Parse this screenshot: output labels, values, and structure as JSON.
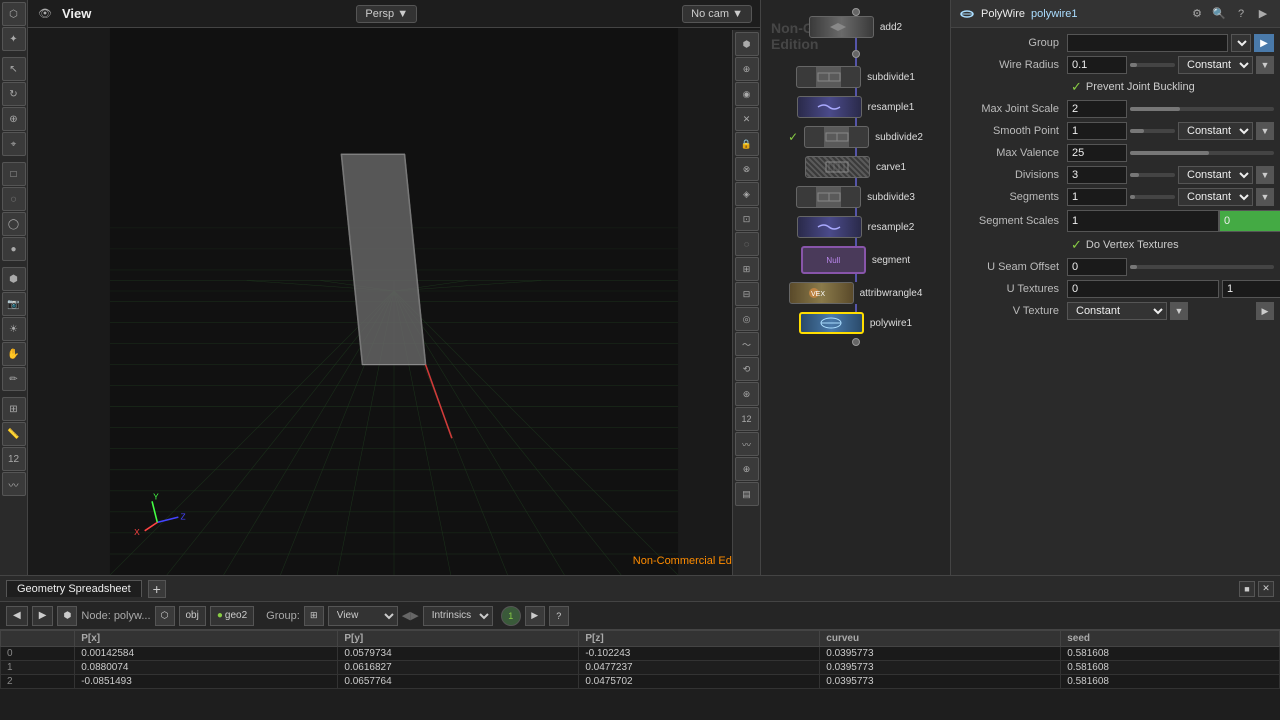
{
  "app": {
    "title": "PolyWire",
    "node_name": "polywire1"
  },
  "viewport": {
    "title": "View",
    "persp_label": "Persp",
    "cam_label": "No cam",
    "non_commercial": "Non-Commercial Edition"
  },
  "properties": {
    "title": "PolyWire",
    "node": "polywire1",
    "rows": [
      {
        "label": "Group",
        "type": "text_dropdown",
        "value": ""
      },
      {
        "label": "Wire Radius",
        "type": "slider_constant",
        "value": "0.1",
        "slider_pct": 15,
        "constant": "Constant"
      },
      {
        "label": "",
        "type": "checkbox",
        "text": "Prevent Joint Buckling",
        "checked": true
      },
      {
        "label": "Max Joint Scale",
        "type": "slider",
        "value": "2",
        "slider_pct": 35
      },
      {
        "label": "Smooth Point",
        "type": "slider_constant",
        "value": "1",
        "slider_pct": 30,
        "constant": "Constant"
      },
      {
        "label": "Max Valence",
        "type": "slider",
        "value": "25",
        "slider_pct": 55
      },
      {
        "label": "Divisions",
        "type": "slider_constant",
        "value": "3",
        "slider_pct": 20,
        "constant": "Constant"
      },
      {
        "label": "Segments",
        "type": "slider_constant",
        "value": "1",
        "slider_pct": 10,
        "constant": "Constant"
      },
      {
        "label": "Segment Scales",
        "type": "dual_color",
        "value1": "1",
        "value2": "0"
      },
      {
        "label": "",
        "type": "checkbox",
        "text": "Do Vertex Textures",
        "checked": true
      },
      {
        "label": "U Seam Offset",
        "type": "slider",
        "value": "0",
        "slider_pct": 5
      },
      {
        "label": "U Textures",
        "type": "dual",
        "value1": "0",
        "value2": "1"
      },
      {
        "label": "V Texture",
        "type": "dropdown",
        "value": "Constant"
      }
    ]
  },
  "nodes": [
    {
      "id": "add2",
      "label": "add2",
      "type": "add",
      "has_top_dot": true,
      "has_bottom_dot": true
    },
    {
      "id": "subdivide1",
      "label": "subdivide1",
      "type": "subdivide"
    },
    {
      "id": "resample1",
      "label": "resample1",
      "type": "resample"
    },
    {
      "id": "subdivide2",
      "label": "subdivide2",
      "type": "subdivide",
      "has_check": true
    },
    {
      "id": "carve1",
      "label": "carve1",
      "type": "carve"
    },
    {
      "id": "subdivide3",
      "label": "subdivide3",
      "type": "subdivide"
    },
    {
      "id": "resample2",
      "label": "resample2",
      "type": "resample"
    },
    {
      "id": "segment",
      "label": "segment",
      "type": "null",
      "sublabel": "Null"
    },
    {
      "id": "attribwrangle4",
      "label": "attribwrangle4",
      "type": "attrib"
    },
    {
      "id": "polywire1",
      "label": "polywire1",
      "type": "polywire",
      "selected": true
    }
  ],
  "spreadsheet": {
    "tabs": [
      "Geometry Spreadsheet"
    ],
    "active_tab": "Geometry Spreadsheet",
    "node_label": "Node: polyw...",
    "obj_btn": "obj",
    "geo_btn": "geo2",
    "group_label": "Group:",
    "view_label": "View",
    "intrinsics_label": "Intrinsics",
    "columns": [
      "",
      "P[x]",
      "P[y]",
      "P[z]",
      "curveu",
      "seed"
    ],
    "rows": [
      {
        "id": "0",
        "px": "0.00142584",
        "py": "0.0579734",
        "pz": "-0.102243",
        "curveu": "0.0395773",
        "seed": "0.581608"
      },
      {
        "id": "1",
        "px": "0.0880074",
        "py": "0.0616827",
        "pz": "0.0477237",
        "curveu": "0.0395773",
        "seed": "0.581608"
      },
      {
        "id": "2",
        "px": "-0.0851493",
        "py": "0.0657764",
        "pz": "0.0475702",
        "curveu": "0.0395773",
        "seed": "0.581608"
      }
    ]
  },
  "icons": {
    "gear": "⚙",
    "search": "🔍",
    "question": "?",
    "arrow_down": "▼",
    "arrow_right": "▶",
    "check": "✓",
    "plus": "+",
    "close": "✕"
  }
}
